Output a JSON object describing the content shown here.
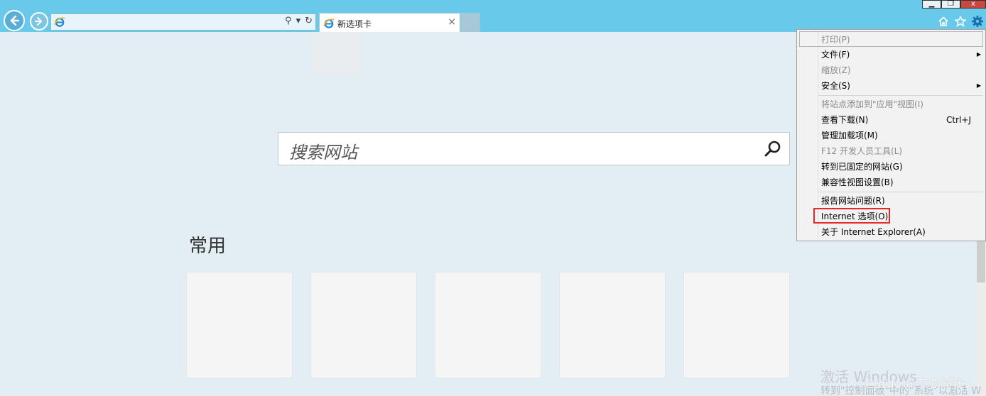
{
  "tab": {
    "title": "新选项卡",
    "close": "×"
  },
  "address": {
    "value": "",
    "search_glyph": "⚲",
    "dropdown_glyph": "▾",
    "refresh_glyph": "↻"
  },
  "window_buttons": {
    "minimize": "▁",
    "restore": "❐",
    "close": "x"
  },
  "search": {
    "placeholder": "搜索网站"
  },
  "frequent": {
    "title": "常用",
    "tile_count": 5
  },
  "menu": {
    "items": [
      {
        "label": "打印(P)",
        "disabled": true,
        "highlight": true
      },
      {
        "label": "文件(F)",
        "submenu": true
      },
      {
        "label": "缩放(Z)",
        "disabled": true
      },
      {
        "label": "安全(S)",
        "submenu": true
      },
      {
        "label": "将站点添加到\"应用\"视图(I)",
        "disabled": true
      },
      {
        "label": "查看下载(N)",
        "shortcut": "Ctrl+J"
      },
      {
        "label": "管理加载项(M)"
      },
      {
        "label": "F12 开发人员工具(L)",
        "disabled": true
      },
      {
        "label": "转到已固定的网站(G)"
      },
      {
        "label": "兼容性视图设置(B)"
      },
      {
        "label": "报告网站问题(R)"
      },
      {
        "label": "Internet 选项(O)",
        "boxed": true
      },
      {
        "label": "关于 Internet Explorer(A)"
      }
    ]
  },
  "watermark": {
    "line1": "激活 Windows",
    "line2": "转到\"控制面板\"中的\"系统\"以激活 W",
    "csdn": "CSDN @不要问我y"
  },
  "colors": {
    "toolbar": "#69c9ea",
    "page": "#e3eef4",
    "highlight_box": "#e22a2a"
  },
  "icons": [
    "back-arrow-icon",
    "forward-arrow-icon",
    "ie-logo-icon",
    "home-icon",
    "favorites-star-icon",
    "gear-icon",
    "search-icon"
  ]
}
